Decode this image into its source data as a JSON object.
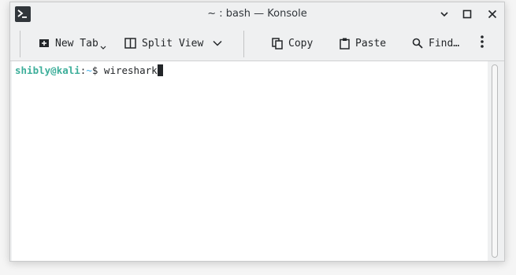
{
  "window": {
    "title": "~ : bash — Konsole"
  },
  "toolbar": {
    "new_tab_label": "New Tab",
    "split_view_label": "Split View",
    "copy_label": "Copy",
    "paste_label": "Paste",
    "find_label": "Find…"
  },
  "terminal": {
    "prompt_user": "shibly",
    "prompt_at": "@",
    "prompt_host": "kali",
    "prompt_colon": ":",
    "prompt_path": "~",
    "prompt_dollar": "$ ",
    "command": "wireshark"
  },
  "icons": {
    "app": "konsole-icon",
    "minimize": "minimize-icon",
    "maximize": "maximize-icon",
    "close": "close-icon",
    "new_tab": "new-tab-icon",
    "split_view": "split-view-icon",
    "copy": "copy-icon",
    "paste": "paste-icon",
    "find": "search-icon",
    "menu": "kebab-menu-icon"
  },
  "colors": {
    "prompt": "#3dae9a",
    "path": "#3daee9",
    "window_bg": "#eff0f1"
  }
}
